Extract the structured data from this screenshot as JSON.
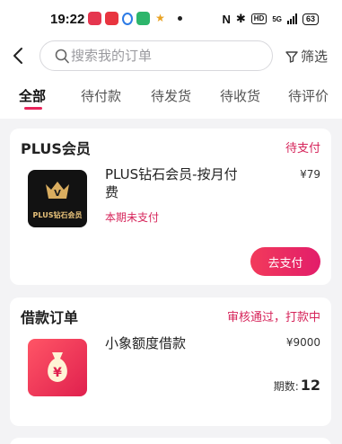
{
  "status_bar": {
    "time": "19:22",
    "notification_icons": [
      "music-app-icon",
      "shopping-app-icon",
      "payment-app-icon",
      "wechat-icon",
      "delivery-app-icon"
    ],
    "system_icons": [
      "nfc-icon",
      "bluetooth-icon",
      "hd-icon",
      "5g-signal-icon",
      "battery-icon"
    ],
    "nfc": "N",
    "bluetooth": "✱",
    "hd": "HD",
    "network": "5G",
    "battery": "63"
  },
  "search": {
    "placeholder": "搜索我的订单",
    "filter_label": "筛选"
  },
  "tabs": [
    {
      "label": "全部",
      "active": true
    },
    {
      "label": "待付款",
      "active": false
    },
    {
      "label": "待发货",
      "active": false
    },
    {
      "label": "待收货",
      "active": false
    },
    {
      "label": "待评价",
      "active": false
    }
  ],
  "orders": [
    {
      "title": "PLUS会员",
      "status": "待支付",
      "image_label": "PLUS钻石会员",
      "image_badge": "V",
      "item_name": "PLUS钻石会员-按月付费",
      "note": "本期未支付",
      "price": "¥79",
      "action": "去支付"
    },
    {
      "title": "借款订单",
      "status": "审核通过，打款中",
      "image_glyph": "¥",
      "item_name": "小象额度借款",
      "price": "¥9000",
      "periods_label": "期数:",
      "periods_value": "12"
    }
  ],
  "colors": {
    "accent": "#e8235a",
    "status_text": "#d6245a",
    "background": "#f3f3f5"
  }
}
